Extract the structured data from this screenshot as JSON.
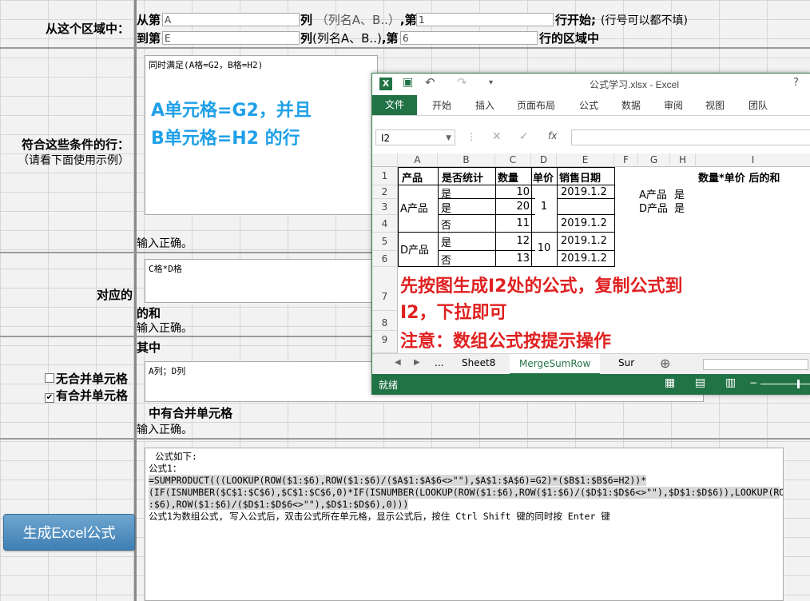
{
  "region": {
    "label": "从这个区域中：",
    "from_prefix": "从第",
    "from_col_value": "A",
    "col_hint1": "列（列名A、B..）,第",
    "from_row_value": "1",
    "row_start": "行开始;",
    "row_note": "(行号可以都不填)",
    "to_prefix": "到第",
    "to_col_value": "E",
    "col_hint2": "列(列名A、B..),第",
    "to_row_value": "6",
    "row_end": "行的区域中"
  },
  "cond": {
    "label": "符合这些条件的行：",
    "sub": "（请看下面使用示例）",
    "text": "同时满足(A格=G2，B格=H2)",
    "ok": "输入正确。",
    "annot_line1": "A单元格=G2，并且",
    "annot_line2": "B单元格=H2 的行"
  },
  "corr": {
    "label": "对应的",
    "text": "C格*D格",
    "suffix": "的和",
    "ok": "输入正确。"
  },
  "merge": {
    "prefix": "其中",
    "opt1": "无合并单元格",
    "opt2": "有合并单元格",
    "text": "A列；D列",
    "suffix": "中有合并单元格",
    "ok": "输入正确。"
  },
  "result": {
    "button": "生成Excel公式",
    "line1": "公式如下:",
    "line2": "公式1：",
    "line3": "=SUMPRODUCT(((LOOKUP(ROW($1:$6),ROW($1:$6)/($A$1:$A$6<>\"\"),$A$1:$A$6)=G2)*($B$1:$B$6=H2))*",
    "line4": "(IF(ISNUMBER($C$1:$C$6),$C$1:$C$6,0)*IF(ISNUMBER(LOOKUP(ROW($1:$6),ROW($1:$6)/($D$1:$D$6<>\"\"),$D$1:$D$6)),LOOKUP(ROW($1",
    "line5": ":$6),ROW($1:$6)/($D$1:$D$6<>\"\"),$D$1:$D$6),0)))",
    "line6": "公式1为数组公式, 写入公式后，双击公式所在单元格，显示公式后，按住 Ctrl Shift 键的同时按 Enter 键"
  },
  "excel": {
    "title": "公式学习.xlsx - Excel",
    "help": "?",
    "tabs": [
      "文件",
      "开始",
      "插入",
      "页面布局",
      "公式",
      "数据",
      "审阅",
      "视图",
      "团队"
    ],
    "namebox": "I2",
    "fx": "fx",
    "col_headers": [
      "A",
      "B",
      "C",
      "D",
      "E",
      "F",
      "G",
      "H",
      "I"
    ],
    "row_headers": [
      "1",
      "2",
      "3",
      "4",
      "5",
      "6",
      "7",
      "8",
      "9"
    ],
    "headers": [
      "产品",
      "是否统计",
      "数量",
      "单价",
      "销售日期"
    ],
    "i1": "数量*单价 后的和",
    "a_group": "A产品",
    "d_group": "D产品",
    "b_values": [
      "是",
      "是",
      "否",
      "是",
      "否"
    ],
    "c_values": [
      "10",
      "20",
      "11",
      "12",
      "13"
    ],
    "d_price1": "1",
    "d_price2": "10",
    "e_values": [
      "2019.1.2",
      "",
      "2019.1.2",
      "2019.1.2",
      "2019.1.2"
    ],
    "g2": "A产品",
    "h2": "是",
    "g3": "D产品",
    "h3": "是",
    "note1": "先按图生成I2处的公式，复制公式到",
    "note2": "I2，下拉即可",
    "note3": "注意：数组公式按提示操作",
    "sheets": [
      "...",
      "Sheet8",
      "MergeSumRow",
      "Sur"
    ],
    "status": "就绪"
  }
}
